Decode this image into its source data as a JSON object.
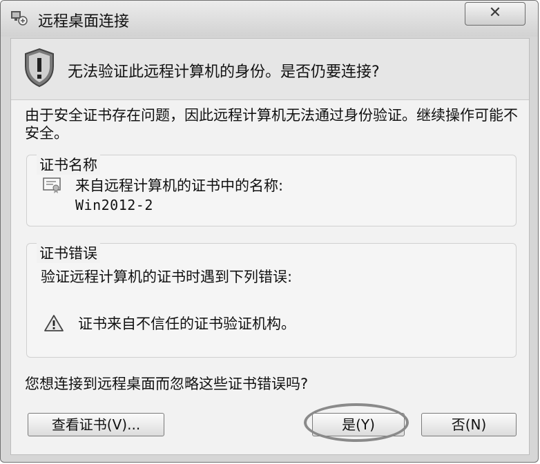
{
  "window": {
    "title": "远程桌面连接",
    "close_label": "✕"
  },
  "header": {
    "message": "无法验证此远程计算机的身份。是否仍要连接?"
  },
  "description": "由于安全证书存在问题，因此远程计算机无法通过身份验证。继续操作可能不安全。",
  "cert_group": {
    "title": "证书名称",
    "label": "来自远程计算机的证书中的名称:",
    "value": "Win2012-2"
  },
  "error_group": {
    "title": "证书错误",
    "intro": "验证远程计算机的证书时遇到下列错误:",
    "error": "证书来自不信任的证书验证机构。"
  },
  "question": "您想连接到远程桌面而忽略这些证书错误吗?",
  "buttons": {
    "view_cert": "查看证书(V)...",
    "yes": "是(Y)",
    "no": "否(N)"
  }
}
